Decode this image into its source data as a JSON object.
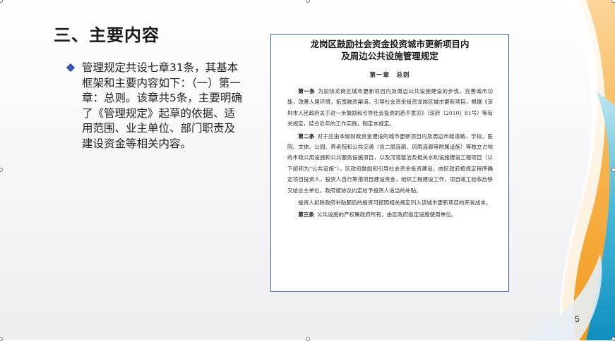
{
  "slide": {
    "title": "三、主要内容",
    "bullet_text": "管理规定共设七章31条，其基本框架和主要内容如下：（一）第一章：总则。该章共5条，主要明确了《管理规定》起草的依据、适用范围、业主单位、部门职责及建设资金等相关内容。",
    "page_number": "5"
  },
  "document": {
    "title_line1": "龙岗区鼓励社会资金投资城市更新项目内",
    "title_line2": "及周边公共设施管理规定",
    "chapter": "第一章　总则",
    "paragraphs": [
      {
        "label": "第一条",
        "text": "为加快龙岗区城市更新项目内及周边公共设施建设的步伐，完善城市功能，改善人居环境，拓宽融资渠道，引导社会资金投资龙岗区城市更新项目，根据《深圳市人民政府关于进一步鼓励和引导社会投资的若干意见》（深府〔2010〕81号）等有关规定，结合近年的工作实践，制定本规定。"
      },
      {
        "label": "第二条",
        "text": "对于应由本级财政资金建设的城市更新项目内及周边市政道路、学校、医院、文体、公园、养老院和公共交通（含二层连廊、风雨连廊等附属设施）等独立占地的市政公用设施和公共服务设施项目，以及河道整治及相关水利设施建设工程项目（以下统称为“公共设施”），区政府鼓励和引导社会资金投资建设，由区政府按规定程序确定项目投资人，投资人自行筹措项目建设资金，组织工程建设工作，项目竣工验收后移交给业主单位。政府按协议约定给予投资人适当的补贴。"
      },
      {
        "label": "",
        "text": "投资人扣除政府补贴额后的投资可按照相关规定列入该城市更新项目的开发成本。"
      },
      {
        "label": "第三条",
        "text": "公共设施的产权属政府所有，由区政府指定设施使用单位。"
      }
    ]
  },
  "colors": {
    "accent_blue": "#3a5fb0",
    "deco_orange": "#f5a623",
    "deco_teal": "#1aa3c8",
    "bullet": "#1f3f99"
  }
}
